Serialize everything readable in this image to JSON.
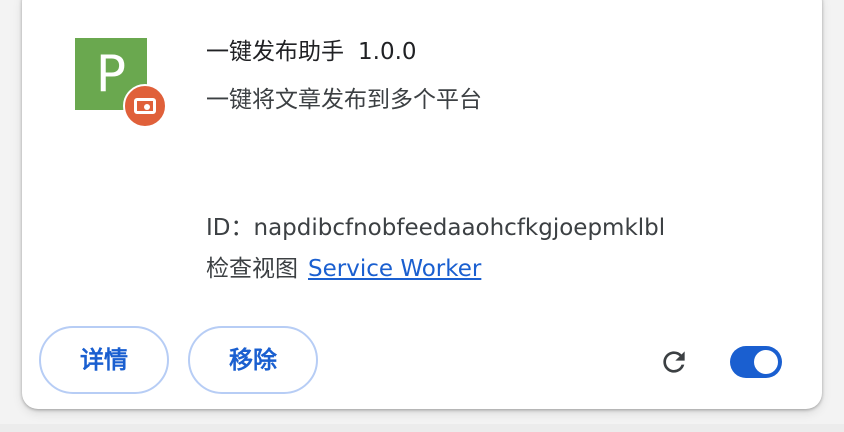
{
  "extension": {
    "icon_letter": "P",
    "icon_color": "#6aa84f",
    "badge_icon": "unpacked-badge-icon",
    "badge_color": "#e0603a",
    "name": "一键发布助手",
    "version": "1.0.0",
    "description": "一键将文章发布到多个平台",
    "id_label": "ID：",
    "id_value": "napdibcfnobfeedaaohcfkgjoepmklbl",
    "inspect_label": "检查视图",
    "inspect_link": "Service Worker",
    "enabled": true
  },
  "actions": {
    "details_label": "详情",
    "remove_label": "移除",
    "reload_icon": "reload-icon"
  },
  "colors": {
    "accent": "#1a5fd0",
    "button_border": "#b7cdf5"
  }
}
